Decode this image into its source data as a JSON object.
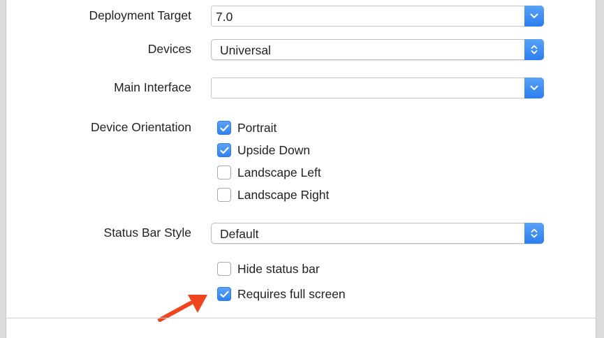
{
  "deployment": {
    "label": "Deployment Target",
    "value": "7.0",
    "control": "chevron-down-icon"
  },
  "devices": {
    "label": "Devices",
    "value": "Universal",
    "control": "updown-chevron-icon"
  },
  "main_interface": {
    "label": "Main Interface",
    "value": "",
    "control": "chevron-down-icon"
  },
  "orientation": {
    "label": "Device Orientation",
    "options": [
      {
        "label": "Portrait",
        "checked": true
      },
      {
        "label": "Upside Down",
        "checked": true
      },
      {
        "label": "Landscape Left",
        "checked": false
      },
      {
        "label": "Landscape Right",
        "checked": false
      }
    ]
  },
  "status_bar": {
    "label": "Status Bar Style",
    "value": "Default",
    "control": "updown-chevron-icon"
  },
  "options": [
    {
      "label": "Hide status bar",
      "checked": false
    },
    {
      "label": "Requires full screen",
      "checked": true
    }
  ],
  "next_section": {
    "title": ""
  },
  "colors": {
    "accent": "#2f82f2",
    "annotation_arrow": "#f0441f"
  }
}
